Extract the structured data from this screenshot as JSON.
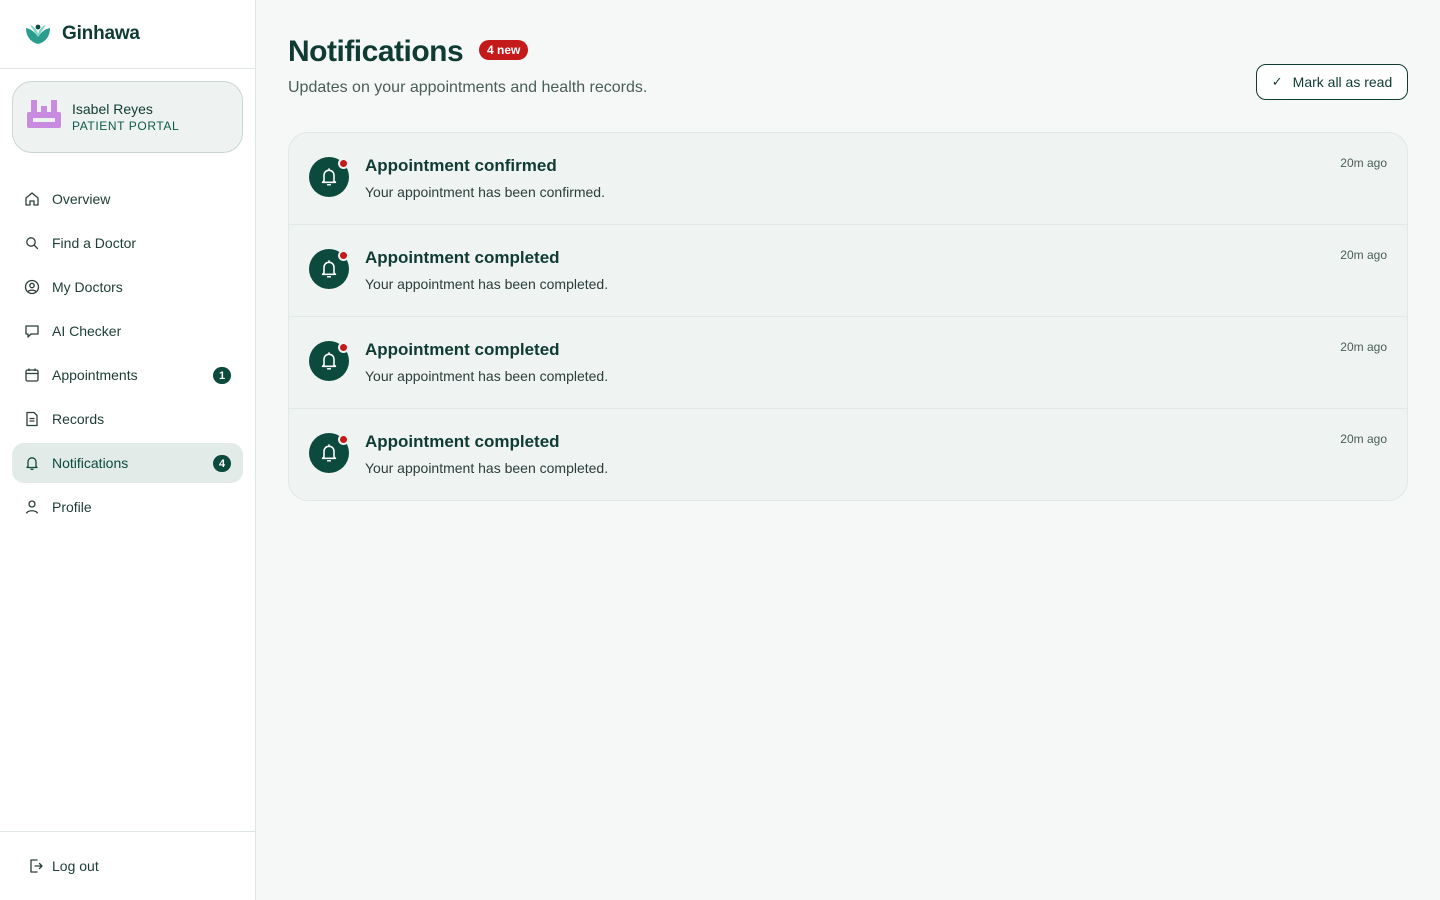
{
  "brand": {
    "name": "Ginhawa"
  },
  "user": {
    "name": "Isabel Reyes",
    "role": "PATIENT PORTAL"
  },
  "nav": {
    "items": [
      {
        "label": "Overview",
        "icon": "home-icon"
      },
      {
        "label": "Find a Doctor",
        "icon": "search-icon"
      },
      {
        "label": "My Doctors",
        "icon": "user-circle-icon"
      },
      {
        "label": "AI Checker",
        "icon": "chat-icon"
      },
      {
        "label": "Appointments",
        "icon": "calendar-icon",
        "badge": "1"
      },
      {
        "label": "Records",
        "icon": "document-icon"
      },
      {
        "label": "Notifications",
        "icon": "bell-icon",
        "badge": "4",
        "active": true
      },
      {
        "label": "Profile",
        "icon": "person-icon"
      }
    ],
    "logout_label": "Log out"
  },
  "page": {
    "title": "Notifications",
    "new_badge": "4 new",
    "subtitle": "Updates on your appointments and health records.",
    "mark_all_label": "Mark all as read"
  },
  "notifications": [
    {
      "title": "Appointment confirmed",
      "body": "Your appointment has been confirmed.",
      "time": "20m ago",
      "unread": true
    },
    {
      "title": "Appointment completed",
      "body": "Your appointment has been completed.",
      "time": "20m ago",
      "unread": true
    },
    {
      "title": "Appointment completed",
      "body": "Your appointment has been completed.",
      "time": "20m ago",
      "unread": true
    },
    {
      "title": "Appointment completed",
      "body": "Your appointment has been completed.",
      "time": "20m ago",
      "unread": true
    }
  ],
  "colors": {
    "primary": "#0c4a3d",
    "accent_red": "#c41a1a",
    "background": "#f5f8f7",
    "avatar_purple": "#c98be0"
  }
}
